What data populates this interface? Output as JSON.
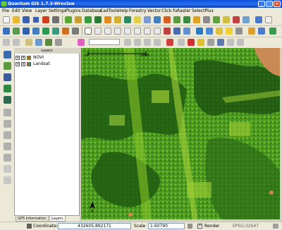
{
  "window": {
    "title": "Quantum GIS 1.7.3-Wroclaw"
  },
  "menu": [
    "File",
    "Edit",
    "View",
    "Layer",
    "Settings",
    "Plugins",
    "Database",
    "CadTools",
    "Help",
    "Forestry",
    "Vector",
    "Click-fu",
    "Raster",
    "SelectPlus"
  ],
  "layers_panel": {
    "title": "Layers",
    "items": [
      {
        "name": "NOVI",
        "checked": "x"
      },
      {
        "name": "Landsat",
        "checked": "x"
      }
    ],
    "tabs": [
      "GPS Information",
      "Layers"
    ]
  },
  "map": {
    "scale_start": "0",
    "scale_end": "2000",
    "north_label": "N"
  },
  "status": {
    "coordinate_label": "Coordinate:",
    "coordinate_value": "432605,892171",
    "scale_label": "Scale",
    "scale_value": "1:60790",
    "render_label": "Render",
    "epsg": "EPSG:32647"
  },
  "colors": {
    "titlebar": "#0a4fd8",
    "map_base": "#2f7a1a",
    "map_light": "#8fcc2a"
  }
}
